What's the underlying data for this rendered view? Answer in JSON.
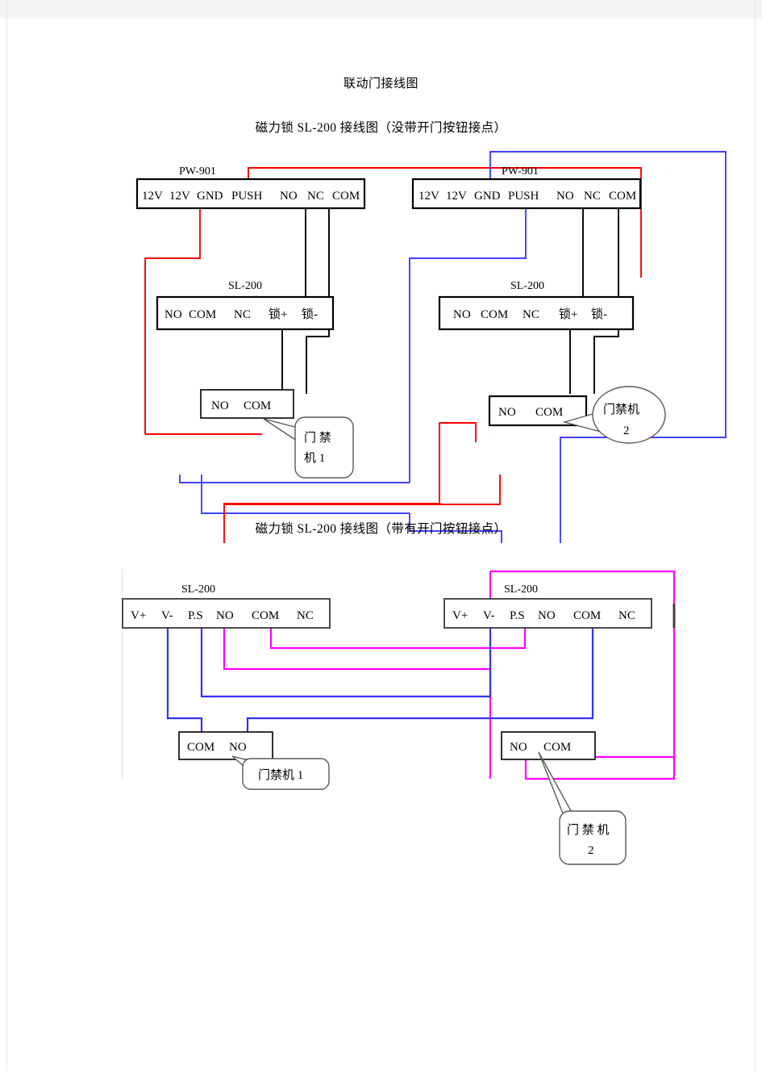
{
  "document": {
    "title": "联动门接线图",
    "section1_title": "磁力锁 SL-200 接线图（没带开门按钮接点）",
    "section2_title": "磁力锁 SL-200 接线图（带有开门按钮接点）"
  },
  "colors": {
    "wire_red": "#ff0000",
    "wire_blue": "#4040ff",
    "wire_black": "#000000",
    "wire_magenta": "#ff00ff",
    "box_border": "#000000",
    "page_background": "#ffffff",
    "outer_background": "#f4f4f4"
  },
  "diagram1": {
    "name": "磁力锁 SL-200 接线图（没带开门按钮接点）",
    "left": {
      "power_supply": {
        "device_name": "PW-901",
        "terminals": [
          "12V",
          "12V",
          "GND",
          "PUSH",
          "NO",
          "NC",
          "COM"
        ]
      },
      "lock_controller": {
        "device_name": "SL-200",
        "terminals": [
          "NO",
          "COM",
          "NC",
          "锁+",
          "锁-"
        ]
      },
      "access_unit": {
        "terminals": [
          "NO",
          "COM"
        ],
        "callout": "门 禁\n机 1",
        "callout_line1": "门 禁",
        "callout_line2": "机 1"
      }
    },
    "right": {
      "power_supply": {
        "device_name": "PW-901",
        "terminals": [
          "12V",
          "12V",
          "GND",
          "PUSH",
          "NO",
          "NC",
          "COM"
        ]
      },
      "lock_controller": {
        "device_name": "SL-200",
        "terminals": [
          "NO",
          "COM",
          "NC",
          "锁+",
          "锁-"
        ]
      },
      "access_unit": {
        "terminals": [
          "NO",
          "COM"
        ],
        "callout": "门禁机\n2",
        "callout_line1": "门禁机",
        "callout_line2": "2"
      }
    }
  },
  "diagram2": {
    "name": "磁力锁 SL-200 接线图（带有开门按钮接点）",
    "left": {
      "lock_controller": {
        "device_name": "SL-200",
        "terminals": [
          "V+",
          "V-",
          "P.S",
          "NO",
          "COM",
          "NC"
        ]
      },
      "access_unit": {
        "terminals": [
          "COM",
          "NO"
        ],
        "callout": "门禁机 1",
        "callout_line1": "门禁机 1",
        "callout_line2": ""
      }
    },
    "right": {
      "lock_controller": {
        "device_name": "SL-200",
        "terminals": [
          "V+",
          "V-",
          "P.S",
          "NO",
          "COM",
          "NC"
        ]
      },
      "access_unit": {
        "terminals": [
          "NO",
          "COM"
        ],
        "callout": "门 禁 机\n2",
        "callout_line1": "门 禁 机",
        "callout_line2": "2"
      }
    }
  }
}
